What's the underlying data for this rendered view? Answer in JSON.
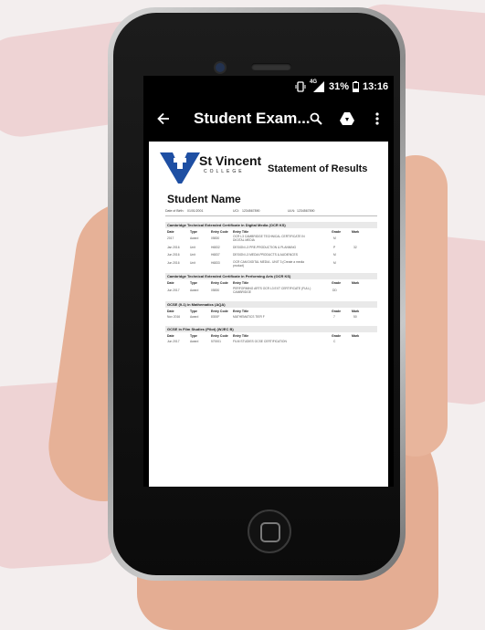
{
  "status_bar": {
    "signal": "4G",
    "battery": "31%",
    "time": "13:16"
  },
  "app_bar": {
    "title": "Student Exam..."
  },
  "document": {
    "college": "St Vincent",
    "college_sub": "COLLEGE",
    "heading": "Statement of Results",
    "student_name": "Student Name",
    "meta": [
      {
        "label": "Date of Birth:",
        "value": "01/01/2001"
      },
      {
        "label": "UCI:",
        "value": "1234567890"
      },
      {
        "label": "ULN:",
        "value": "1234567890"
      }
    ],
    "column_headers": {
      "date": "Date",
      "type": "Type",
      "entry_code": "Entry Code",
      "entry_title": "Entry Title",
      "grade": "Grade",
      "mark": "Mark"
    },
    "sections": [
      {
        "title": "Cambridge Technical Extended Certificate in Digital Media (OCR KS)",
        "rows": [
          {
            "date": "2017",
            "type": "Award",
            "code": "05830",
            "title": "OCR L3 CAMBRIDGE TECHNICAL CERTIFICATE IN DIGITAL MEDIA",
            "grade": "M",
            "mark": ""
          },
          {
            "date": "Jan 2016",
            "type": "Unit",
            "code": "H6832",
            "title": "DESIGN L3 PRE-PRODUCTION & PLANNING",
            "grade": "P",
            "mark": "32"
          },
          {
            "date": "Jun 2016",
            "type": "Unit",
            "code": "H6837",
            "title": "DESIGN L3 MEDIA PRODUCTS & AUDIENCES",
            "grade": "M",
            "mark": ""
          },
          {
            "date": "Jun 2016",
            "type": "Unit",
            "code": "H6833",
            "title": "OCR CAM DIGITAL MEDIA - UNIT 3 (Create a media product)",
            "grade": "M",
            "mark": ""
          }
        ]
      },
      {
        "title": "Cambridge Technical Extended Certificate in Performing Arts (OCR KS)",
        "rows": [
          {
            "date": "Jun 2017",
            "type": "Award",
            "code": "05830",
            "title": "PERFORMING ARTS OCR L3 EXT CERTIFICATE (FULL) CAMBRIDGE",
            "grade": "DD",
            "mark": ""
          }
        ]
      },
      {
        "title": "GCSE (9-1) in Mathematics (AQA)",
        "rows": [
          {
            "date": "Nov 2016",
            "type": "Award",
            "code": "8300F",
            "title": "MATHEMATICS TIER F",
            "grade": "7",
            "mark": "50"
          }
        ]
      },
      {
        "title": "GCSE in Film Studies (Pilot) (WJEC B)",
        "rows": [
          {
            "date": "Jun 2017",
            "type": "Award",
            "code": "570001",
            "title": "FILM STUDIES GCSE CERTIFICATION",
            "grade": "C",
            "mark": ""
          }
        ]
      }
    ]
  },
  "colors": {
    "fab": "#3b7de9",
    "app_bar": "#000000",
    "logo_blue": "#1e4fa3"
  },
  "icons": [
    "back-arrow-icon",
    "search-icon",
    "drive-icon",
    "more-vert-icon",
    "edit-pencil-icon",
    "battery-icon",
    "signal-icon",
    "vibrate-icon"
  ]
}
